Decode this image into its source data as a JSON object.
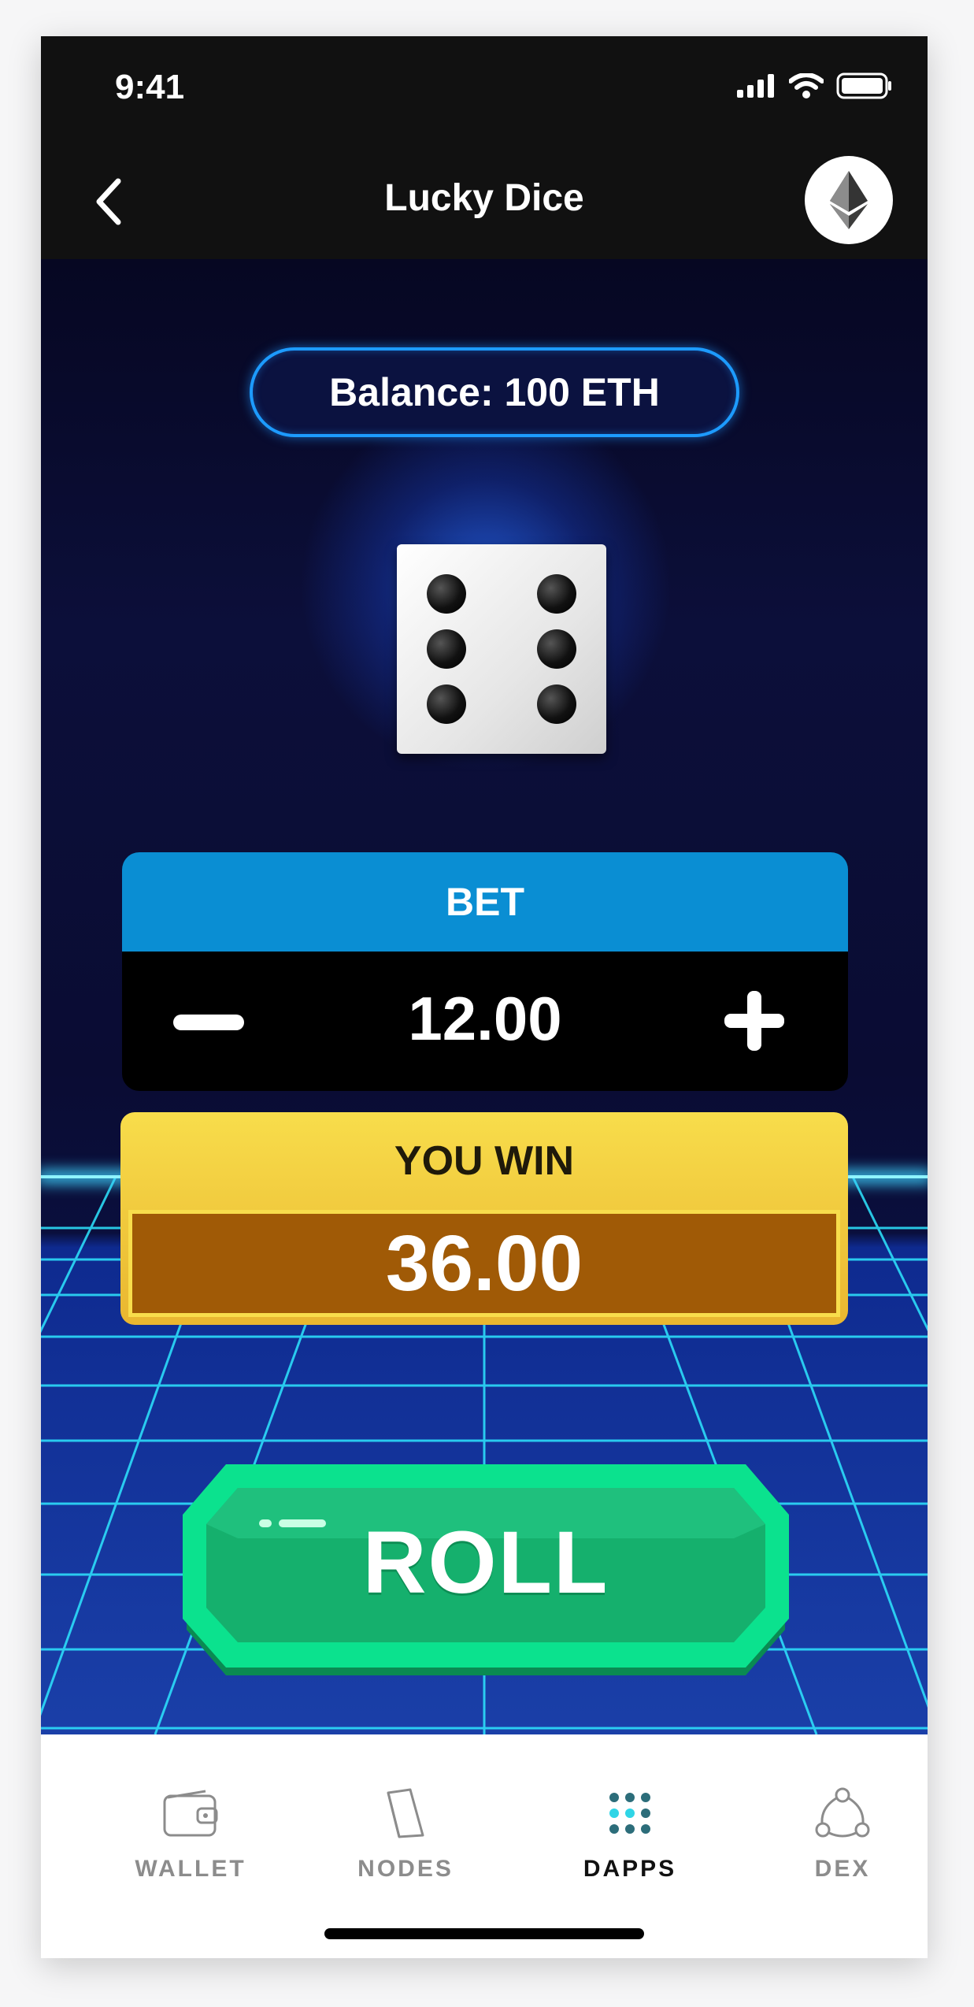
{
  "status_bar": {
    "time": "9:41"
  },
  "header": {
    "title": "Lucky Dice"
  },
  "balance": {
    "label": "Balance: 100 ETH"
  },
  "dice": {
    "face_value": 6
  },
  "bet": {
    "label": "BET",
    "value": "12.00"
  },
  "win": {
    "label": "YOU WIN",
    "value": "36.00"
  },
  "roll_button": {
    "label": "ROLL"
  },
  "tabs": [
    {
      "label": "WALLET",
      "icon": "wallet-icon"
    },
    {
      "label": "NODES",
      "icon": "nodes-icon"
    },
    {
      "label": "DAPPS",
      "icon": "dapps-icon",
      "active": true
    },
    {
      "label": "DEX",
      "icon": "dex-icon"
    }
  ],
  "colors": {
    "bet_header": "#0a8ed3",
    "win_gold": "#f8dd4b",
    "win_value_bg": "#a05a06",
    "roll_green": "#0be28e",
    "grid_cyan": "#2ee6ff"
  }
}
